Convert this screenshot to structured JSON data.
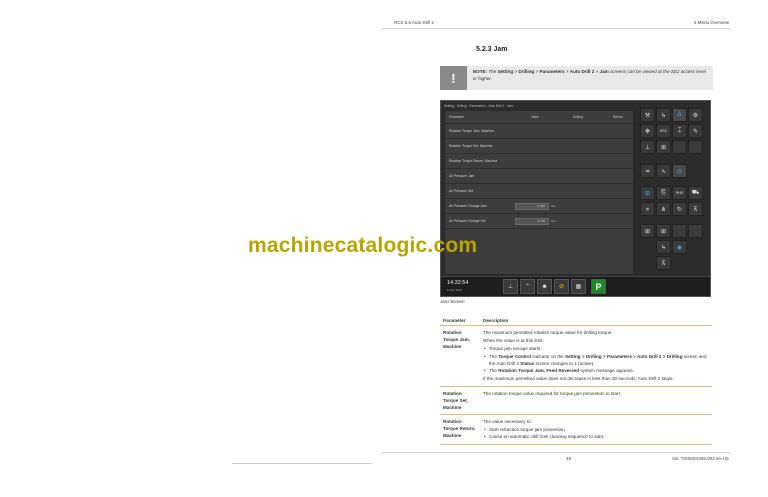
{
  "header": {
    "left": "RCS 5.6 Auto Drill 2",
    "right": "5 Menu Overview"
  },
  "section_title": "5.2.3 Jam",
  "note": {
    "icon": "!",
    "prefix": "NOTE:",
    "t1": " The ",
    "setting": "Setting",
    "gt1": " > ",
    "drilling": "Drilling",
    "gt2": " > ",
    "parameters": "Parameters",
    "gt3": " > ",
    "autodrill": "Auto Drill 2",
    "gt4": " > ",
    "jam": "Jam",
    "t2": " screens can be viewed at the SE2 access level or higher."
  },
  "screen": {
    "breadcrumb": "Setting - Drilling - Parameters - Auto Drill 2 - Jam",
    "columns": [
      "Parameter",
      "Value",
      "Drilling",
      "Return"
    ],
    "rows": [
      {
        "label": "Rotation Torque Jam, Machine",
        "value": "",
        "unit": ""
      },
      {
        "label": "Rotation Torque Set, Machine",
        "value": "",
        "unit": ""
      },
      {
        "label": "Rotation Torque Return, Machine",
        "value": "",
        "unit": ""
      },
      {
        "label": "Air Pressure Jam",
        "value": "",
        "unit": ""
      },
      {
        "label": "Air Pressure Set",
        "value": "",
        "unit": ""
      },
      {
        "label": "Air Pressure Change Jam",
        "value": "0.340",
        "unit": "bar"
      },
      {
        "label": "Air Pressure Change Set",
        "value": "0.710",
        "unit": "bar"
      }
    ],
    "time": "14:32:54",
    "date": "11 Apr 2024",
    "bottom_p": "P",
    "rhs": "RHS",
    "arc": "ARC"
  },
  "caption": "Jam Screen",
  "table": {
    "h_param": "Parameter",
    "h_desc": "Description",
    "r1_param": "Rotation Torque Jam, Machine",
    "r1_d1": "The maximum permitted rotation torque value for drilling torque.",
    "r1_d2": "When the value is at this limit:",
    "r1_b1": "Torque jam escape starts.",
    "r1_b2a": "The ",
    "r1_b2_tc": "Torque Control",
    "r1_b2b": " indicator on the ",
    "r1_b2_path": "Setting > Drilling > Parameters > Auto Drill 2 > Drilling",
    "r1_b2c": " screen and the Auto Drill 2 ",
    "r1_b2_status": "Status",
    "r1_b2d": " screen changes to 1 (active).",
    "r1_b3a": "The ",
    "r1_b3_msg": "Rotation Torque Jam, Feed Reversed",
    "r1_b3b": " system message appears.",
    "r1_d3": "If the maximum permitted value does not decrease in less than 30 seconds, Auto Drill 2 stops.",
    "r2_param": "Rotation Torque Set, Machine",
    "r2_d1": "The rotation torque value required for torque jam prevention to start.",
    "r3_param": "Rotation Torque Return, Machine",
    "r3_d1": "The value necessary to:",
    "r3_b1": "Start retraction torque jam prevention.",
    "r3_b2": "Cause an automatic drill hole cleaning sequence to start."
  },
  "footer": {
    "page": "49",
    "doc": "No: TIS0004399.003 en-US"
  },
  "watermark": "machinecatalogic.com"
}
